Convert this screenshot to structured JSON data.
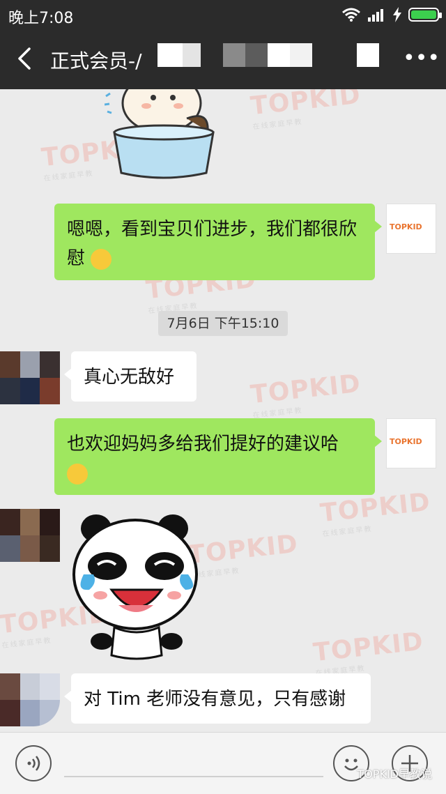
{
  "status_bar": {
    "time": "晚上7:08"
  },
  "header": {
    "title": "正式会员-/"
  },
  "messages": [
    {
      "from": "me",
      "text": "嗯嗯，看到宝贝们进步，我们都很欣慰"
    },
    {
      "from": "them",
      "text": "真心无敌好"
    },
    {
      "from": "me",
      "text": "也欢迎妈妈多给我们提好的建议哈"
    },
    {
      "from": "them",
      "text": "对 Tim 老师没有意见，只有感谢"
    }
  ],
  "timestamp": "7月6日 下午15:10",
  "watermark": {
    "brand": "TOPKID",
    "tagline": "在线家庭早教"
  },
  "avatar_logo": "TOPKID",
  "footer_credit": "TOPKID早教说",
  "icons": {
    "back": "back-arrow-icon",
    "more": "more-icon",
    "voice": "voice-icon",
    "emoji": "emoji-icon",
    "plus": "plus-icon"
  },
  "colors": {
    "my_bubble": "#9fe75f",
    "their_bubble": "#ffffff",
    "header_bg": "#2b2b2b"
  }
}
